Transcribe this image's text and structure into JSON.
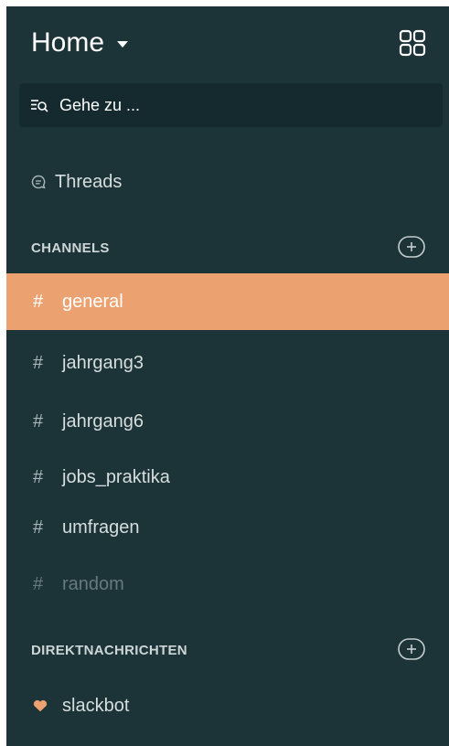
{
  "header": {
    "workspace_name": "Home"
  },
  "jump_to": {
    "label": "Gehe zu ..."
  },
  "threads": {
    "label": "Threads"
  },
  "channels_section": {
    "title": "CHANNELS"
  },
  "channels": [
    {
      "name": "general",
      "prefix": "#",
      "active": true
    },
    {
      "name": "jahrgang3",
      "prefix": "#"
    },
    {
      "name": "jahrgang6",
      "prefix": "#"
    },
    {
      "name": "jobs_praktika",
      "prefix": "#"
    },
    {
      "name": "umfragen",
      "prefix": "#"
    },
    {
      "name": "random",
      "prefix": "#",
      "muted": true
    }
  ],
  "dm_section": {
    "title": "DIREKTNACHRICHTEN"
  },
  "direct_messages": [
    {
      "name": "slackbot",
      "icon": "heart-icon"
    }
  ],
  "colors": {
    "sidebar_bg": "#1c3338",
    "active_bg": "#eba270",
    "heart": "#eba270"
  }
}
